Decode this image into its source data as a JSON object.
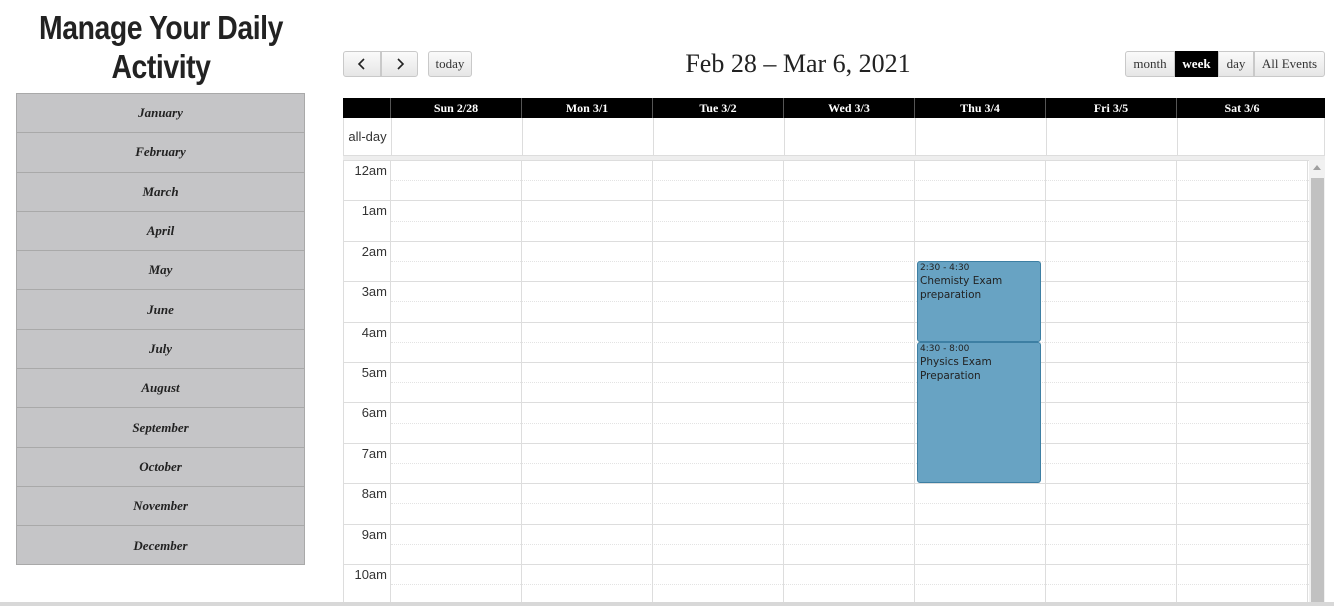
{
  "app": {
    "title": "Manage Your Daily Activity"
  },
  "months": [
    "January",
    "February",
    "March",
    "April",
    "May",
    "June",
    "July",
    "August",
    "September",
    "October",
    "November",
    "December"
  ],
  "toolbar": {
    "prev_icon": "chevron-left-icon",
    "next_icon": "chevron-right-icon",
    "today_label": "today",
    "range_title": "Feb 28 – Mar 6, 2021",
    "views": [
      "month",
      "week",
      "day",
      "All Events"
    ],
    "active_view": "week"
  },
  "calendar": {
    "days": [
      "Sun 2/28",
      "Mon 3/1",
      "Tue 3/2",
      "Wed 3/3",
      "Thu 3/4",
      "Fri 3/5",
      "Sat 3/6"
    ],
    "allday_label": "all-day",
    "time_labels": [
      "12am",
      "1am",
      "2am",
      "3am",
      "4am",
      "5am",
      "6am",
      "7am",
      "8am",
      "9am",
      "10am"
    ],
    "events": [
      {
        "time": "2:30 - 4:30",
        "title": "Chemisty Exam preparation",
        "day": "Thu 3/4",
        "start_hour": 2.5,
        "end_hour": 4.5
      },
      {
        "time": "4:30 - 8:00",
        "title": "Physics Exam Preparation",
        "day": "Thu 3/4",
        "start_hour": 4.5,
        "end_hour": 8.0
      }
    ]
  },
  "colors": {
    "event_bg": "#68a3c3",
    "active_view_bg": "#000000",
    "header_bg": "#000000",
    "sidebar_bg": "#c5c5c7"
  }
}
